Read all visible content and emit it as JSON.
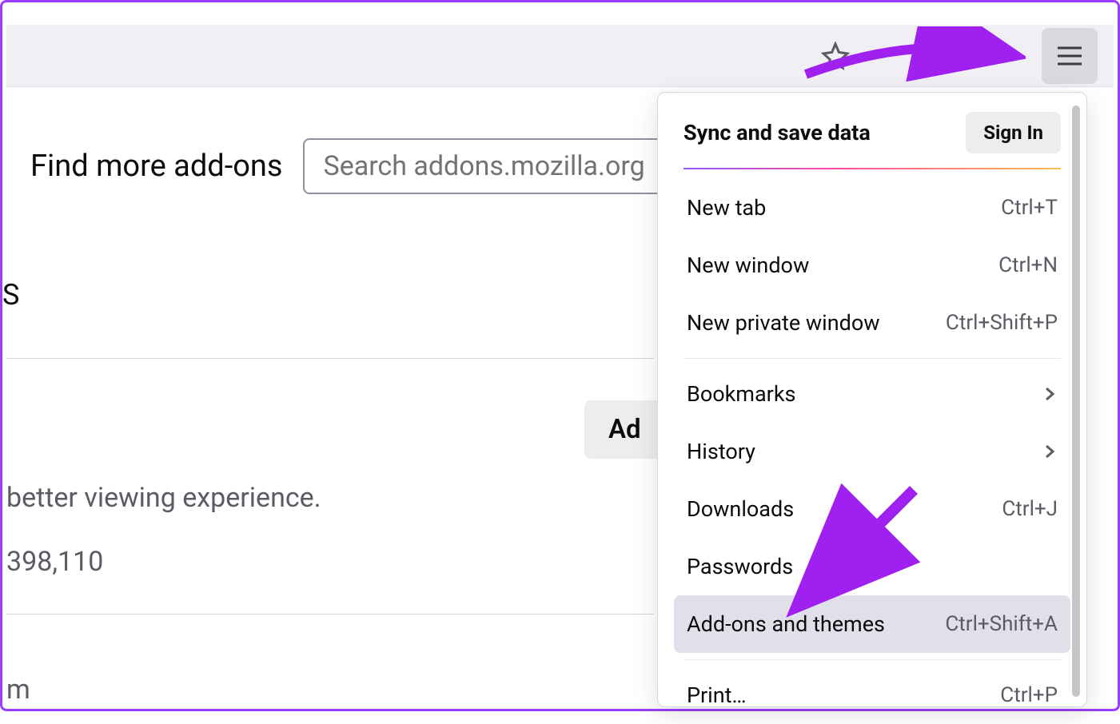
{
  "toolbar": {
    "hamburger_label": "Open application menu"
  },
  "content": {
    "find_label": "Find more add-ons",
    "search_placeholder": "Search addons.mozilla.org",
    "partial_s": "S",
    "ad_button": "Ad",
    "desc": "better viewing experience.",
    "num": "398,110",
    "partial_m": "m"
  },
  "menu": {
    "sync_label": "Sync and save data",
    "signin": "Sign In",
    "items": [
      {
        "label": "New tab",
        "shortcut": "Ctrl+T"
      },
      {
        "label": "New window",
        "shortcut": "Ctrl+N"
      },
      {
        "label": "New private window",
        "shortcut": "Ctrl+Shift+P"
      }
    ],
    "items2": [
      {
        "label": "Bookmarks",
        "chevron": true
      },
      {
        "label": "History",
        "chevron": true
      },
      {
        "label": "Downloads",
        "shortcut": "Ctrl+J"
      },
      {
        "label": "Passwords"
      }
    ],
    "highlighted": {
      "label": "Add-ons and themes",
      "shortcut": "Ctrl+Shift+A"
    },
    "items3": [
      {
        "label": "Print…",
        "shortcut": "Ctrl+P"
      }
    ]
  }
}
